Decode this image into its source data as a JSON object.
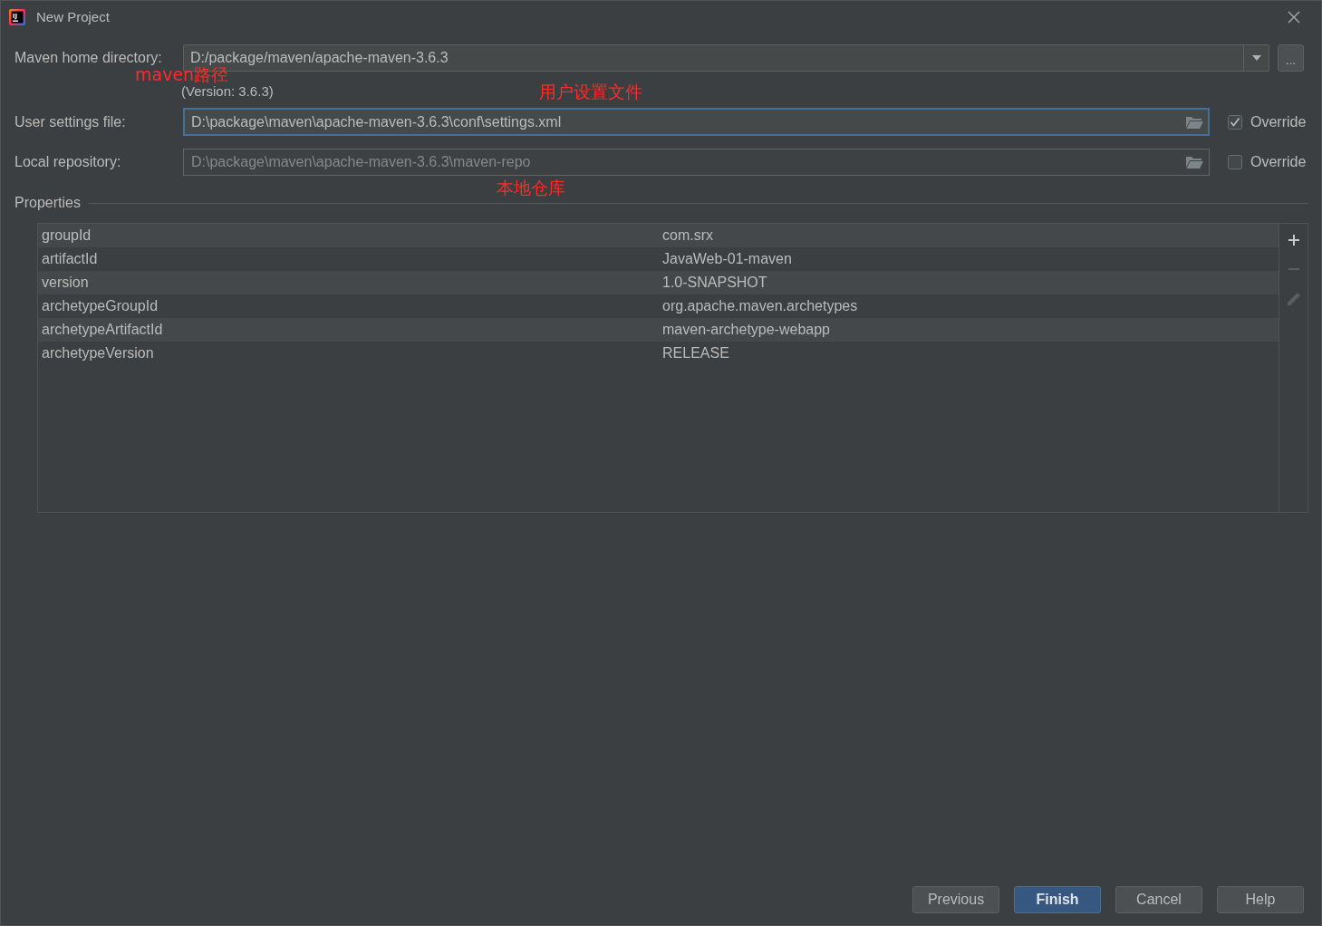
{
  "window": {
    "title": "New Project",
    "logo_text": "IJ"
  },
  "maven_home": {
    "label": "Maven home directory:",
    "value": "D:/package/maven/apache-maven-3.6.3",
    "browse": "...",
    "version": "(Version: 3.6.3)"
  },
  "settings_rows": [
    {
      "label": "User settings file:",
      "value": "D:\\package\\maven\\apache-maven-3.6.3\\conf\\settings.xml",
      "focused": true,
      "disabled": false,
      "override": {
        "label": "Override",
        "checked": true
      }
    },
    {
      "label": "Local repository:",
      "value": "D:\\package\\maven\\apache-maven-3.6.3\\maven-repo",
      "focused": false,
      "disabled": true,
      "override": {
        "label": "Override",
        "checked": false
      }
    }
  ],
  "properties": {
    "title": "Properties",
    "rows": [
      {
        "name": "groupId",
        "value": "com.srx",
        "selected": false
      },
      {
        "name": "artifactId",
        "value": "JavaWeb-01-maven",
        "selected": false
      },
      {
        "name": "version",
        "value": "1.0-SNAPSHOT",
        "selected": false
      },
      {
        "name": "archetypeGroupId",
        "value": "org.apache.maven.archetypes",
        "selected": false
      },
      {
        "name": "archetypeArtifactId",
        "value": "maven-archetype-webapp",
        "selected": false
      },
      {
        "name": "archetypeVersion",
        "value": "RELEASE",
        "selected": false
      }
    ],
    "tools": [
      {
        "kind": "add",
        "disabled": false
      },
      {
        "kind": "remove",
        "disabled": true
      },
      {
        "kind": "edit",
        "disabled": true
      }
    ]
  },
  "buttons": [
    {
      "label": "Previous",
      "kind": "default"
    },
    {
      "label": "Finish",
      "kind": "primary"
    },
    {
      "label": "Cancel",
      "kind": "default"
    },
    {
      "label": "Help",
      "kind": "default"
    }
  ],
  "annotations": [
    {
      "text": "maven路径"
    },
    {
      "text": "用户设置文件"
    },
    {
      "text": "本地仓库"
    }
  ]
}
